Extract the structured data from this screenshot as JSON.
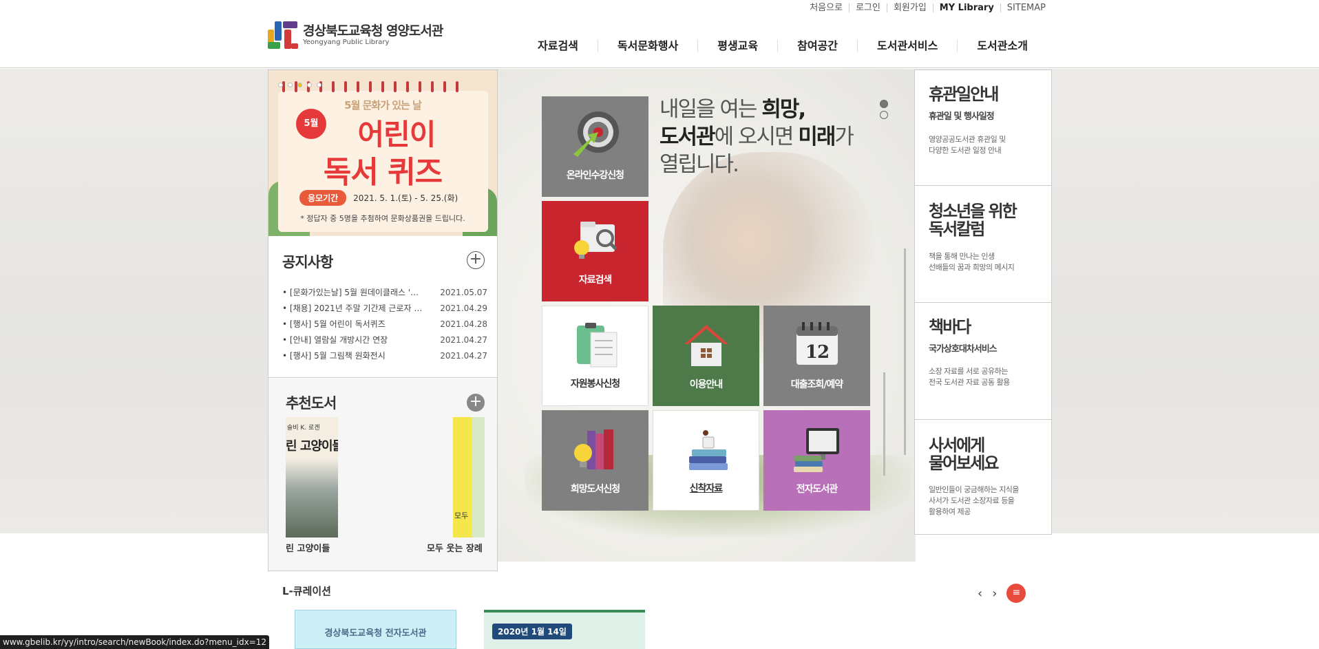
{
  "util_links": [
    "처음으로",
    "로그인",
    "회원가입",
    "MY Library",
    "SITEMAP"
  ],
  "logo": {
    "title": "경상북도교육청 영양도서관",
    "subtitle": "Yeongyang Public Library"
  },
  "gnb": [
    "자료검색",
    "독서문화행사",
    "평생교육",
    "참여공간",
    "도서관서비스",
    "도서관소개"
  ],
  "banner": {
    "top_text": "5월 문화가 있는 날",
    "month_badge": "5월",
    "line1": "어린이",
    "line2": "독서 퀴즈",
    "period_label": "응모기간",
    "period_value": "2021. 5. 1.(토) - 5. 25.(화)",
    "note": "* 정답자 중 5명을 추첨하여 문화상품권을 드립니다."
  },
  "notice": {
    "title": "공지사항",
    "items": [
      {
        "text": "[문화가있는날] 5월 원데이클래스 '…",
        "date": "2021.05.07"
      },
      {
        "text": "[채용] 2021년 주말 기간제 근로자 …",
        "date": "2021.04.29"
      },
      {
        "text": "[행사] 5월 어린이 독서퀴즈",
        "date": "2021.04.28"
      },
      {
        "text": "[안내] 열람실 개방시간 연장",
        "date": "2021.04.27"
      },
      {
        "text": "[행사] 5월 그림책 원화전시",
        "date": "2021.04.27"
      }
    ]
  },
  "recommend": {
    "title": "추천도서",
    "books": [
      {
        "cover_text": "슬비 K. 로겐",
        "cover_title": "린 고양이들",
        "title": "린 고양이들"
      },
      {
        "cover_text": "모두",
        "title": "모두 웃는 장례"
      }
    ]
  },
  "hero": {
    "slogan_l1_pre": "내일을 여는 ",
    "slogan_l1_bold": "희망,",
    "slogan_l2_bold1": "도서관",
    "slogan_l2_mid": "에 오시면 ",
    "slogan_l2_bold2": "미래",
    "slogan_l2_post": "가",
    "slogan_l3": "열립니다."
  },
  "tiles": [
    {
      "label": "온라인수강신청",
      "color": "#808080"
    },
    {
      "label": "자료검색",
      "color": "#c9252f"
    },
    {
      "label": "자원봉사신청",
      "color": "#ffffff"
    },
    {
      "label": "이용안내",
      "color": "#4e7a4a"
    },
    {
      "label": "대출조회/예약",
      "color": "#808080"
    },
    {
      "label": "희망도서신청",
      "color": "#808080"
    },
    {
      "label": "신착자료",
      "color": "#ffffff"
    },
    {
      "label": "전자도서관",
      "color": "#b870b8"
    }
  ],
  "calendar_day": "12",
  "right_boxes": [
    {
      "title": "휴관일안내",
      "subtitle": "휴관일 및 행사일정",
      "desc1": "영양공공도서관 휴관일 및",
      "desc2": "다양한 도서관 일정 안내",
      "desc3": ""
    },
    {
      "title1": "청소년을 위한",
      "title2": "독서칼럼",
      "desc1": "책을 통해 만나는 인생",
      "desc2": "선배들의 꿈과 희망의 메시지",
      "desc3": ""
    },
    {
      "title": "책바다",
      "subtitle": "국가상호대차서비스",
      "desc1": "소장 자료를 서로 공유하는",
      "desc2": "전국 도서관 자료 공동 활용",
      "desc3": ""
    },
    {
      "title1": "사서에게",
      "title2": "물어보세요",
      "desc1": "일반인들이 궁금해하는 지식을",
      "desc2": "사서가 도서관 소장자료 등을",
      "desc3": "활용하여 제공"
    }
  ],
  "curation": {
    "title": "L-큐레이션",
    "card1": "경상북도교육청 전자도서관",
    "card2_badge": "2020년 1월 14일"
  },
  "status_url": "www.gbelib.kr/yy/intro/search/newBook/index.do?menu_idx=12"
}
